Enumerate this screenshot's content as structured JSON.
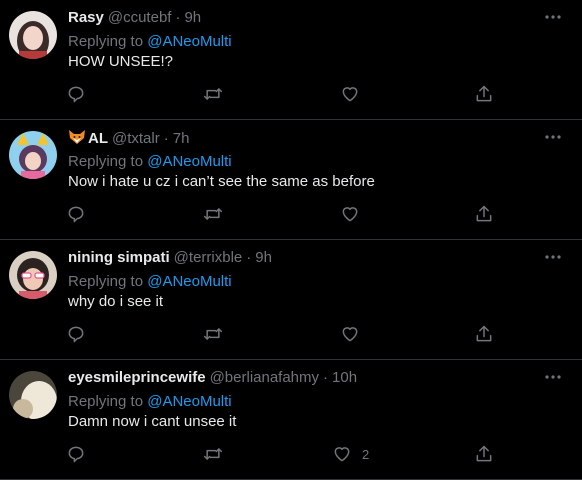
{
  "reply_prefix": "Replying to",
  "colors": {
    "background": "#000000",
    "text": "#e7e9ea",
    "muted": "#71767b",
    "link": "#1d9bf0",
    "divider": "#2f3336"
  },
  "tweets": [
    {
      "name": "Rasy",
      "handle": "@ccutebf",
      "dot": "·",
      "time": "9h",
      "reply_to": "@ANeoMulti",
      "text": "HOW UNSEE!?",
      "like_count": ""
    },
    {
      "name": "AL",
      "name_emoji": "fox-icon",
      "handle": "@txtalr",
      "dot": "·",
      "time": "7h",
      "reply_to": "@ANeoMulti",
      "text": "Now i hate u cz i can’t see the same as before",
      "like_count": ""
    },
    {
      "name": "nining simpati",
      "handle": "@terrixble",
      "dot": "·",
      "time": "9h",
      "reply_to": "@ANeoMulti",
      "text": "why do i see it",
      "like_count": ""
    },
    {
      "name": "eyesmileprincewife",
      "handle": "@berlianafahmy",
      "dot": "·",
      "time": "10h",
      "reply_to": "@ANeoMulti",
      "text": "Damn now i cant unsee it",
      "like_count": "2"
    }
  ]
}
